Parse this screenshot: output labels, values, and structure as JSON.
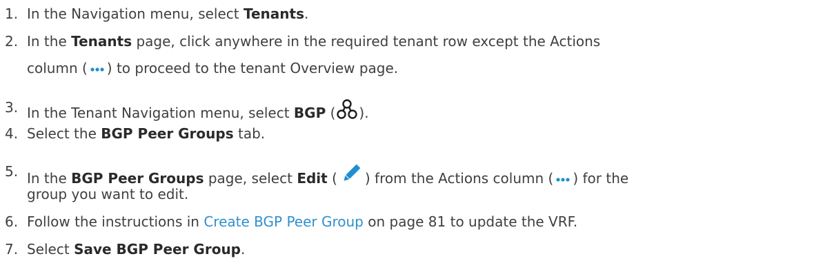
{
  "colors": {
    "text": "#3f3f3f",
    "link": "#2f8fd0",
    "icon_dots": "#1f8fcf",
    "icon_bgp": "#1d1d1d",
    "icon_pencil": "#1f8fcf"
  },
  "icons": {
    "actions": "ellipsis-icon",
    "bgp": "bgp-network-icon",
    "edit": "pencil-icon"
  },
  "steps": [
    {
      "num": "1.",
      "pre": "In the Navigation menu, select ",
      "bold": "Tenants",
      "post": "."
    },
    {
      "num": "2.",
      "pre": "In the ",
      "bold": "Tenants",
      "mid": " page, click anywhere in the required tenant row except the Actions",
      "l2a": "column (",
      "l2b": ") to proceed to the tenant Overview page."
    },
    {
      "num": "3.",
      "pre": "In the Tenant Navigation menu, select ",
      "bold": "BGP",
      "mid": " (",
      "post": ")."
    },
    {
      "num": "4.",
      "pre": "Select the ",
      "bold": "BGP Peer Groups",
      "post": " tab."
    },
    {
      "num": "5.",
      "pre": "In the ",
      "bold": "BGP Peer Groups",
      "mid": " page, select ",
      "bold2": "Edit",
      "mid2": " (",
      "mid3": ") from the Actions column (",
      "post": ") for the",
      "l2": "group you want to edit."
    },
    {
      "num": "6.",
      "pre": "Follow the instructions in ",
      "link": "Create BGP Peer Group",
      "post": " on page 81 to update the VRF."
    },
    {
      "num": "7.",
      "pre": "Select ",
      "bold": "Save BGP Peer Group",
      "post": "."
    }
  ]
}
